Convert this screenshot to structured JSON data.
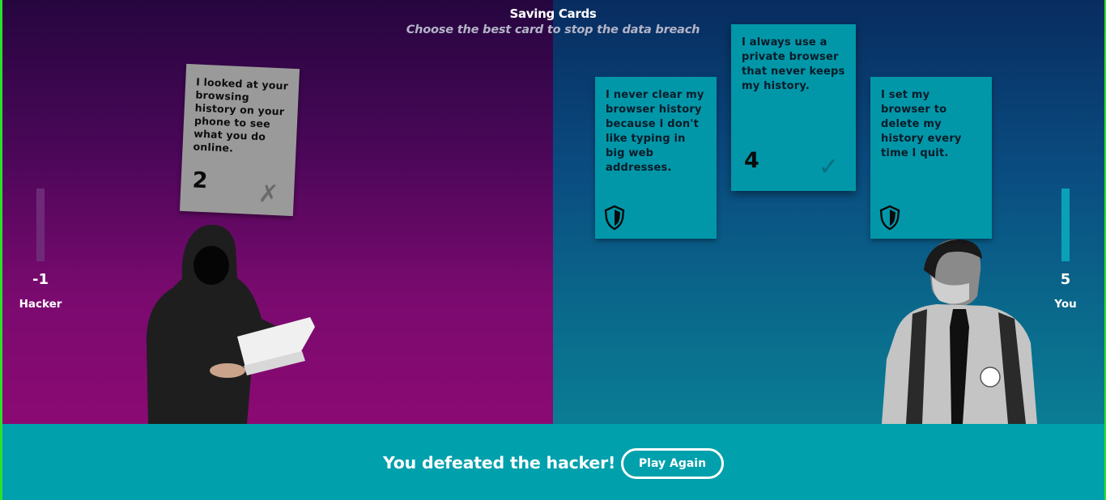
{
  "header": {
    "title": "Saving Cards",
    "subtitle": "Choose the best card to stop the data breach"
  },
  "hacker": {
    "label": "Hacker",
    "score": "-1",
    "card": {
      "text": "I looked at your browsing history on your phone to see what you do online.",
      "number": "2",
      "mark": "✗"
    }
  },
  "player": {
    "label": "You",
    "score": "5",
    "cards": [
      {
        "text": "I never clear my browser history because I don't like typing in big web addresses.",
        "icon": "shield-icon"
      },
      {
        "text": "I always use a private browser that never keeps my history.",
        "number": "4",
        "mark": "✓"
      },
      {
        "text": "I set my browser to delete my history every time I quit.",
        "icon": "shield-icon"
      }
    ]
  },
  "footer": {
    "result": "You defeated the hacker!",
    "play_again": "Play Again"
  },
  "colors": {
    "hacker_bg_top": "#26063f",
    "hacker_bg_bottom": "#8a0a72",
    "player_bg_top": "#082c60",
    "player_bg_bottom": "#0a7d94",
    "card_teal": "#0197a9",
    "card_grey": "#9a9a9a",
    "footer_bg": "#00a0ac"
  }
}
